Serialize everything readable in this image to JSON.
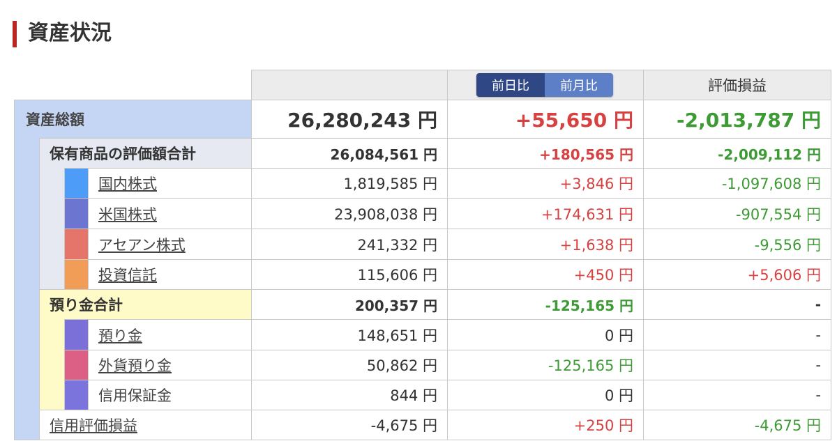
{
  "page": {
    "title": "資産状況"
  },
  "header": {
    "toggle": {
      "day_label": "前日比",
      "month_label": "前月比",
      "active": "day"
    },
    "pl_label": "評価損益"
  },
  "total": {
    "label": "資産総額",
    "value": "26,280,243 円",
    "change": "+55,650 円",
    "pl": "-2,013,787 円"
  },
  "holdings": {
    "label": "保有商品の評価額合計",
    "value": "26,084,561 円",
    "change": "+180,565 円",
    "pl": "-2,009,112 円",
    "items": [
      {
        "label": "国内株式",
        "value": "1,819,585 円",
        "change": "+3,846 円",
        "pl": "-1,097,608 円",
        "color": "#4d9cf7"
      },
      {
        "label": "米国株式",
        "value": "23,908,038 円",
        "change": "+174,631 円",
        "pl": "-907,554 円",
        "color": "#6c75d0"
      },
      {
        "label": "アセアン株式",
        "value": "241,332 円",
        "change": "+1,638 円",
        "pl": "-9,556 円",
        "color": "#e5756a"
      },
      {
        "label": "投資信託",
        "value": "115,606 円",
        "change": "+450 円",
        "pl": "+5,606 円",
        "color": "#f19d58"
      }
    ]
  },
  "deposits": {
    "label": "預り金合計",
    "value": "200,357 円",
    "change": "-125,165 円",
    "pl": "-",
    "items": [
      {
        "label": "預り金",
        "value": "148,651 円",
        "change": "0 円",
        "pl": "-",
        "color": "#7b70d8"
      },
      {
        "label": "外貨預り金",
        "value": "50,862 円",
        "change": "-125,165 円",
        "pl": "-",
        "color": "#dc5f86"
      },
      {
        "label": "信用保証金",
        "value": "844 円",
        "change": "0 円",
        "pl": "-",
        "color": "#7b74dc"
      }
    ]
  },
  "margin": {
    "label": "信用評価損益",
    "value": "-4,675 円",
    "change": "+250 円",
    "pl": "-4,675 円"
  },
  "colors": {
    "title_bar": "#b8281e",
    "positive": "#d64141",
    "negative": "#3d9a35",
    "toggle_active": "#2f4785",
    "toggle_inactive": "#5d7fc8"
  }
}
